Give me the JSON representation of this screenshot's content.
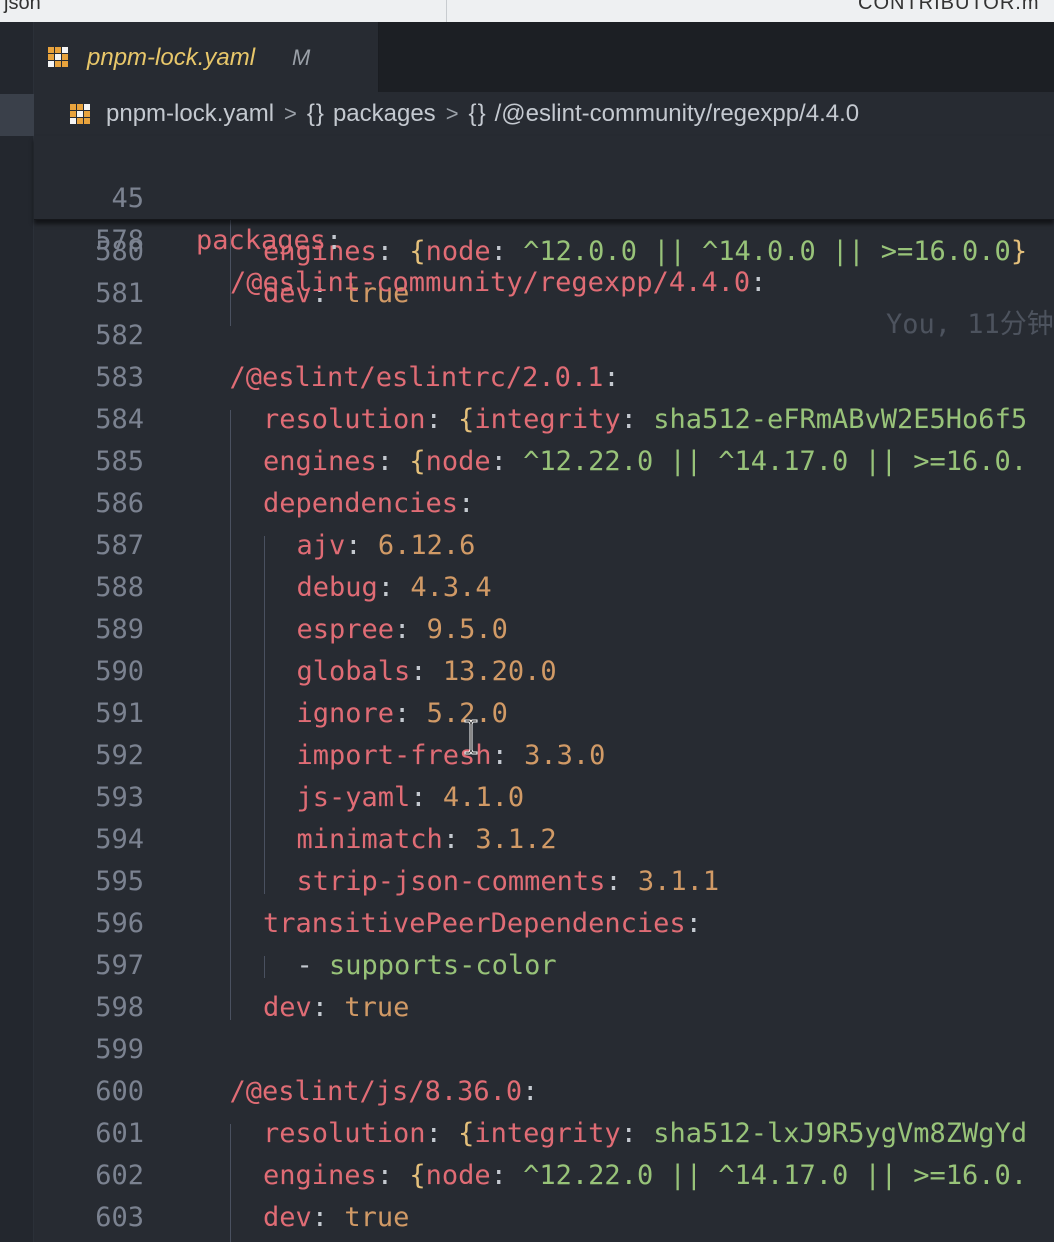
{
  "top_strip": {
    "left_text": "json",
    "right_text": "CONTRIBUTOR.m"
  },
  "tab": {
    "title": "pnpm-lock.yaml",
    "modified": "M",
    "icon": "yaml-file-icon"
  },
  "breadcrumb": {
    "file": "pnpm-lock.yaml",
    "seg1": "packages",
    "seg2": "/@eslint-community/regexpp/4.4.0",
    "brace": "{}",
    "chevron": ">"
  },
  "sticky": {
    "l1": {
      "num": "45",
      "key": "packages"
    },
    "l2": {
      "num": "578",
      "key": "/@eslint-community/regexpp/4.4.0",
      "blame": "You, 11分钟"
    }
  },
  "colors": {
    "key": "#e06c75",
    "number": "#d19a66",
    "string": "#98c379",
    "brace": "#e5c07b",
    "gutter": "#7b8290"
  },
  "lines": [
    {
      "num": "580",
      "k": "engines",
      "a": "{",
      "ak": "node",
      "val": "^12.0.0 || ^14.0.0 || >=16.0.0",
      "z": "}"
    },
    {
      "num": "581",
      "k": "dev",
      "val": "true"
    },
    {
      "num": "582"
    },
    {
      "num": "583",
      "k": "/@eslint/eslintrc/2.0.1"
    },
    {
      "num": "584",
      "k": "resolution",
      "a": "{",
      "ak": "integrity",
      "val": "sha512-eFRmABvW2E5Ho6f5"
    },
    {
      "num": "585",
      "k": "engines",
      "a": "{",
      "ak": "node",
      "val": "^12.22.0 || ^14.17.0 || >=16.0."
    },
    {
      "num": "586",
      "k": "dependencies"
    },
    {
      "num": "587",
      "k": "ajv",
      "val": "6.12.6"
    },
    {
      "num": "588",
      "k": "debug",
      "val": "4.3.4"
    },
    {
      "num": "589",
      "k": "espree",
      "val": "9.5.0"
    },
    {
      "num": "590",
      "k": "globals",
      "val": "13.20.0"
    },
    {
      "num": "591",
      "k": "ignore",
      "val": "5.2.0"
    },
    {
      "num": "592",
      "k": "import-fresh",
      "val": "3.3.0"
    },
    {
      "num": "593",
      "k": "js-yaml",
      "val": "4.1.0"
    },
    {
      "num": "594",
      "k": "minimatch",
      "val": "3.1.2"
    },
    {
      "num": "595",
      "k": "strip-json-comments",
      "val": "3.1.1"
    },
    {
      "num": "596",
      "k": "transitivePeerDependencies"
    },
    {
      "num": "597",
      "dash": "-",
      "item": "supports-color"
    },
    {
      "num": "598",
      "k": "dev",
      "val": "true"
    },
    {
      "num": "599"
    },
    {
      "num": "600",
      "k": "/@eslint/js/8.36.0"
    },
    {
      "num": "601",
      "k": "resolution",
      "a": "{",
      "ak": "integrity",
      "val": "sha512-lxJ9R5ygVm8ZWgYd"
    },
    {
      "num": "602",
      "k": "engines",
      "a": "{",
      "ak": "node",
      "val": "^12.22.0 || ^14.17.0 || >=16.0."
    },
    {
      "num": "603",
      "k": "dev",
      "val": "true"
    }
  ],
  "colon": ":"
}
